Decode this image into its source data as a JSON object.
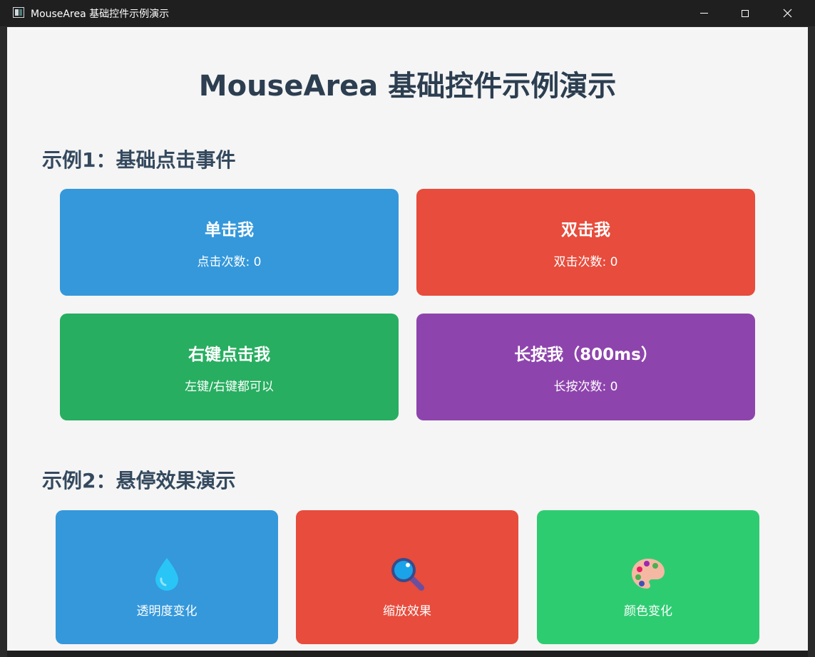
{
  "window": {
    "title": "MouseArea 基础控件示例演示",
    "minimize_label": "—",
    "maximize_label": "□",
    "close_label": "✕"
  },
  "page": {
    "title": "MouseArea 基础控件示例演示"
  },
  "section1": {
    "title": "示例1：基础点击事件",
    "cards": [
      {
        "title": "单击我",
        "subtitle": "点击次数: 0",
        "color": "#3498db"
      },
      {
        "title": "双击我",
        "subtitle": "双击次数: 0",
        "color": "#e74c3c"
      },
      {
        "title": "右键点击我",
        "subtitle": "左键/右键都可以",
        "color": "#27ae60"
      },
      {
        "title": "长按我（800ms）",
        "subtitle": "长按次数: 0",
        "color": "#8e44ad"
      }
    ]
  },
  "section2": {
    "title": "示例2：悬停效果演示",
    "cards": [
      {
        "label": "透明度变化",
        "icon": "droplet-icon",
        "color": "#3498db"
      },
      {
        "label": "缩放效果",
        "icon": "magnifier-icon",
        "color": "#e74c3c"
      },
      {
        "label": "颜色变化",
        "icon": "palette-icon",
        "color": "#2ecc71"
      }
    ]
  }
}
